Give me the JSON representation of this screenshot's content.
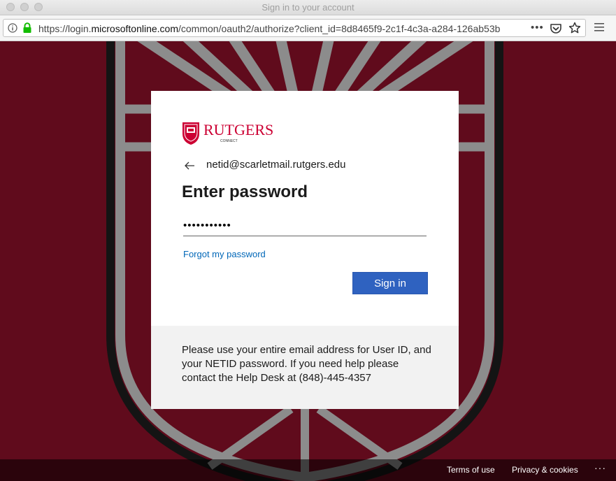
{
  "window": {
    "title": "Sign in to your account"
  },
  "browser": {
    "url_prefix": "https://login.",
    "url_domain": "microsoftonline.com",
    "url_rest": "/common/oauth2/authorize?client_id=8d8465f9-2c1f-4c3a-a284-126ab53b",
    "more_label": "•••",
    "icons": [
      "info-icon",
      "lock-icon",
      "pocket-icon",
      "star-icon",
      "menu-icon"
    ]
  },
  "signin": {
    "brand": "RUTGERS",
    "brand_sub": "CONNECT",
    "identity": "netid@scarletmail.rutgers.edu",
    "heading": "Enter password",
    "password_value": "•••••••••••",
    "forgot_label": "Forgot my password",
    "button_label": "Sign in",
    "help_text": "Please use your entire email address for User ID, and your NETID password. If you need help please contact the Help Desk at (848)-445-4357"
  },
  "footer": {
    "terms_label": "Terms of use",
    "privacy_label": "Privacy & cookies",
    "more_label": "···"
  },
  "colors": {
    "background": "#600b1c",
    "button": "#2f62c0",
    "link": "#0067b8",
    "brand_red": "#cc0033"
  }
}
